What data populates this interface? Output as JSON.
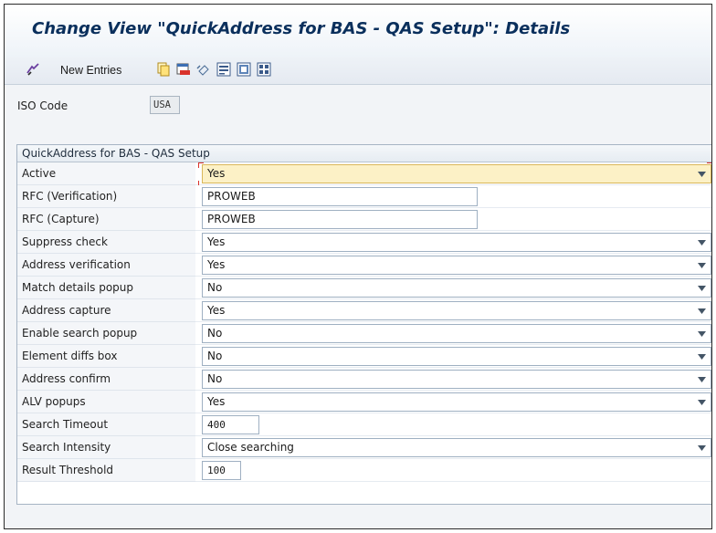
{
  "window": {
    "title": "Change View \"QuickAddress for BAS - QAS Setup\": Details"
  },
  "toolbar": {
    "new_entries_label": "New Entries"
  },
  "header_fields": {
    "iso_code_label": "ISO Code",
    "iso_code_value": "USA"
  },
  "group": {
    "title": "QuickAddress for BAS - QAS Setup",
    "rows": [
      {
        "label": "Active",
        "value": "Yes"
      },
      {
        "label": "RFC (Verification)",
        "value": "PROWEB"
      },
      {
        "label": "RFC (Capture)",
        "value": "PROWEB"
      },
      {
        "label": "Suppress check",
        "value": "Yes"
      },
      {
        "label": "Address verification",
        "value": "Yes"
      },
      {
        "label": "Match details popup",
        "value": "No"
      },
      {
        "label": "Address capture",
        "value": "Yes"
      },
      {
        "label": "Enable search popup",
        "value": "No"
      },
      {
        "label": "Element diffs box",
        "value": "No"
      },
      {
        "label": "Address confirm",
        "value": "No"
      },
      {
        "label": "ALV popups",
        "value": "Yes"
      },
      {
        "label": "Search Timeout",
        "value": "400"
      },
      {
        "label": "Search Intensity",
        "value": "Close searching"
      },
      {
        "label": "Result Threshold",
        "value": "100"
      }
    ]
  },
  "colors": {
    "title_text": "#0a2f5c",
    "active_field_bg": "#fcf1c6",
    "focus_marker": "#d9322b"
  },
  "icons": [
    "display-change-icon",
    "copy-icon",
    "delete-icon",
    "undo-icon",
    "select-all-icon",
    "select-block-icon",
    "deselect-all-icon"
  ]
}
